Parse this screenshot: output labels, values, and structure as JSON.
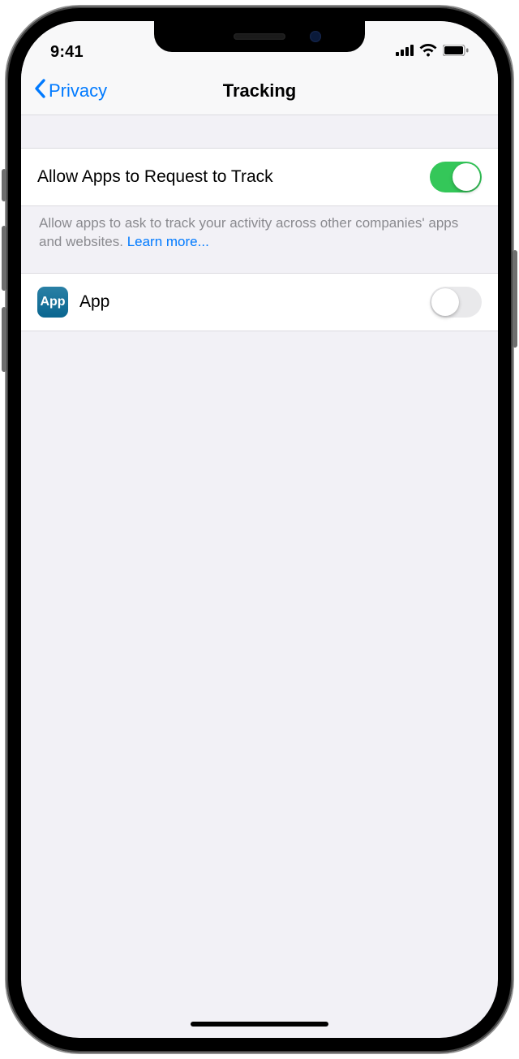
{
  "status": {
    "time": "9:41"
  },
  "nav": {
    "back_label": "Privacy",
    "title": "Tracking"
  },
  "settings": {
    "allow_row": {
      "label": "Allow Apps to Request to Track",
      "enabled": true
    },
    "footer": {
      "text": "Allow apps to ask to track your activity across other companies' apps and websites. ",
      "link": "Learn more..."
    },
    "apps": [
      {
        "icon_label": "App",
        "name": "App",
        "enabled": false
      }
    ]
  }
}
